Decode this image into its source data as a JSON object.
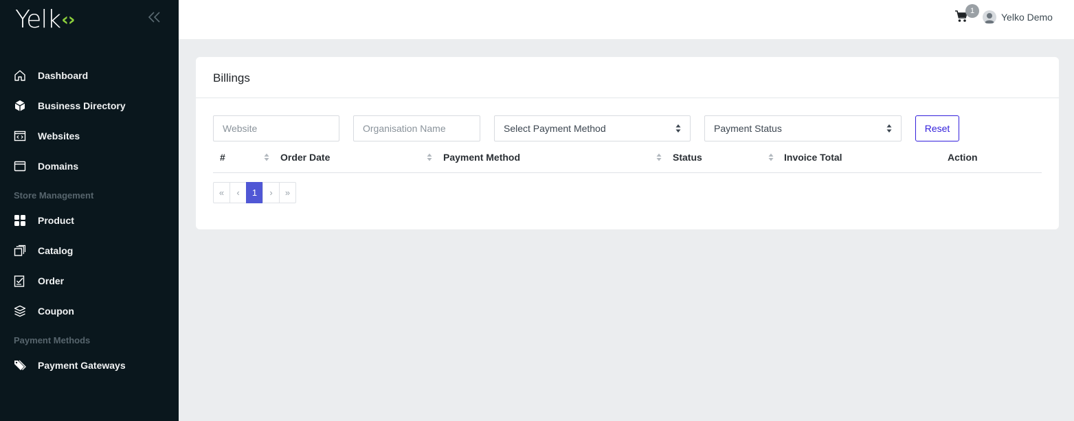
{
  "brand": {
    "logo_text": "Yelk",
    "logo_mark": "‹›"
  },
  "sidebar": {
    "items": [
      {
        "label": "Dashboard",
        "icon": "home-icon"
      },
      {
        "label": "Business Directory",
        "icon": "box-icon"
      },
      {
        "label": "Websites",
        "icon": "code-window-icon"
      },
      {
        "label": "Domains",
        "icon": "browser-icon"
      },
      {
        "label": "Product",
        "icon": "grid-icon"
      },
      {
        "label": "Catalog",
        "icon": "copy-icon"
      },
      {
        "label": "Order",
        "icon": "checklist-icon"
      },
      {
        "label": "Coupon",
        "icon": "layers-icon"
      },
      {
        "label": "Payment Gateways",
        "icon": "tags-icon"
      }
    ],
    "sections": [
      "Store Management",
      "Payment Methods"
    ]
  },
  "header": {
    "cart_count": "1",
    "user_name": "Yelko Demo"
  },
  "card": {
    "title": "Billings",
    "filters": {
      "website_placeholder": "Website",
      "organisation_placeholder": "Organisation Name",
      "payment_method_selected": "Select Payment Method",
      "payment_status_selected": "Payment Status",
      "reset_label": "Reset"
    },
    "table": {
      "columns": [
        "#",
        "Order Date",
        "Payment Method",
        "Status",
        "Invoice Total",
        "Action"
      ],
      "rows": []
    },
    "pagination": {
      "first": "«",
      "prev": "‹",
      "current": "1",
      "next": "›",
      "last": "»"
    }
  },
  "colors": {
    "sidebar_bg": "#0a171d",
    "accent": "#321fdb",
    "active_page": "#5057d5",
    "logo_accent": "#8dd03c"
  }
}
